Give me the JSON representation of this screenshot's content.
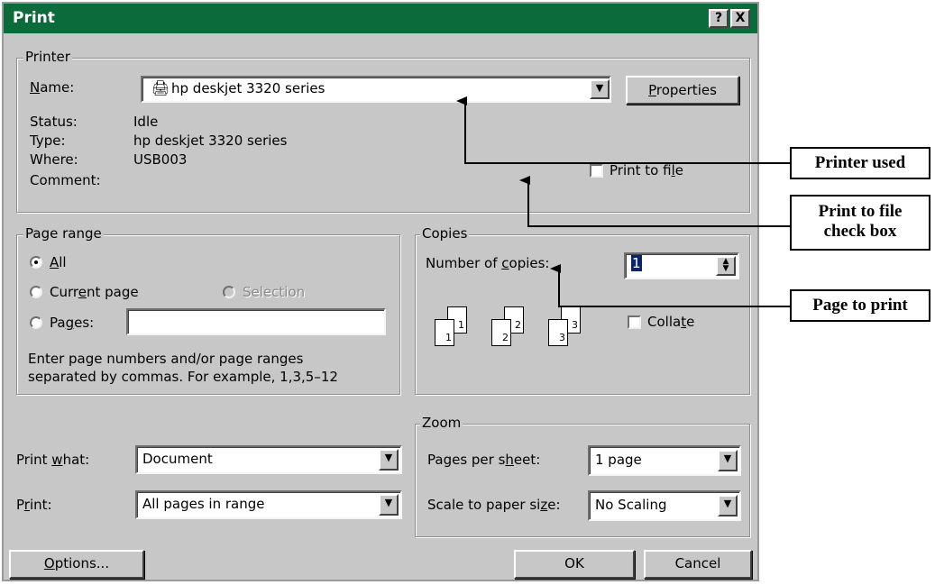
{
  "dialog": {
    "title": "Print",
    "help_button": "?",
    "close_button": "X"
  },
  "printer": {
    "group_label": "Printer",
    "name_label": "Name:",
    "name_value": "hp deskjet 3320 series",
    "properties_button": "Properties",
    "status_label": "Status:",
    "status_value": "Idle",
    "type_label": "Type:",
    "type_value": "hp deskjet 3320 series",
    "where_label": "Where:",
    "where_value": "USB003",
    "comment_label": "Comment:",
    "print_to_file_label": "Print to file"
  },
  "page_range": {
    "group_label": "Page range",
    "all_label": "All",
    "current_page_label": "Current page",
    "selection_label": "Selection",
    "pages_label": "Pages:",
    "pages_value": "",
    "hint_line1": "Enter page numbers and/or page ranges",
    "hint_line2": "separated by commas.  For example, 1,3,5–12",
    "selected": "All"
  },
  "copies": {
    "group_label": "Copies",
    "number_label": "Number of copies:",
    "number_value": "1",
    "collate_label": "Collate",
    "collate_checked": false,
    "page_icons": [
      "1",
      "1",
      "2",
      "2",
      "3",
      "3"
    ]
  },
  "print_what": {
    "label": "Print what:",
    "value": "Document"
  },
  "print": {
    "label": "Print:",
    "value": "All pages in range"
  },
  "zoom": {
    "group_label": "Zoom",
    "pages_per_sheet_label": "Pages per sheet:",
    "pages_per_sheet_value": "1 page",
    "scale_label": "Scale to paper size:",
    "scale_value": "No Scaling"
  },
  "footer": {
    "options_button": "Options...",
    "ok_button": "OK",
    "cancel_button": "Cancel"
  },
  "callouts": {
    "printer_used": "Printer used",
    "print_to_file_line1": "Print to file",
    "print_to_file_line2": "check box",
    "page_to_print": "Page to print"
  },
  "colors": {
    "titlebar": "#0b6b3a",
    "dialog_face": "#c7c7c7"
  }
}
